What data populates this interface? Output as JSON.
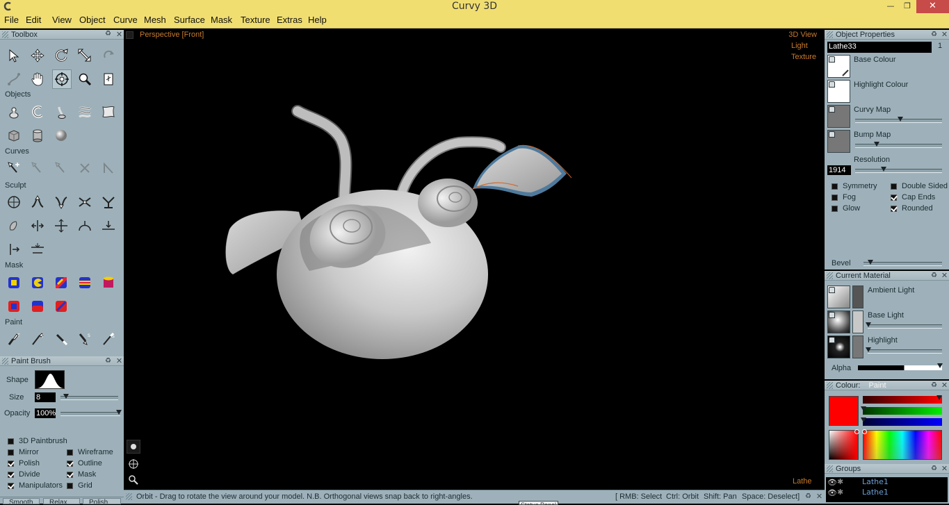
{
  "window": {
    "title": "Curvy 3D"
  },
  "menu": [
    "File",
    "Edit",
    "View",
    "Object",
    "Curve",
    "Mesh",
    "Surface",
    "Mask",
    "Texture",
    "Extras",
    "Help"
  ],
  "toolbox": {
    "title": "Toolbox",
    "sections": {
      "objects": "Objects",
      "curves": "Curves",
      "sculpt": "Sculpt",
      "mask": "Mask",
      "paint": "Paint"
    }
  },
  "paint_brush": {
    "title": "Paint Brush",
    "shape_label": "Shape",
    "size_label": "Size",
    "size_value": "8",
    "size_level": 0.1,
    "opacity_label": "Opacity",
    "opacity_value": "100%",
    "opacity_level": 1.0,
    "options": [
      {
        "label": "3D Paintbrush",
        "checked": false
      },
      {
        "label": "Mirror",
        "checked": false
      },
      {
        "label": "Wireframe",
        "checked": false
      },
      {
        "label": "Polish",
        "checked": true
      },
      {
        "label": "Outline",
        "checked": true
      },
      {
        "label": "Divide",
        "checked": true
      },
      {
        "label": "Mask",
        "checked": true
      },
      {
        "label": "Manipulators",
        "checked": true
      },
      {
        "label": "Grid",
        "checked": false
      }
    ]
  },
  "viewport": {
    "view_name": "Perspective [Front]",
    "modes": [
      "3D View",
      "Light",
      "Texture"
    ],
    "object_type": "Lathe"
  },
  "object_properties": {
    "title": "Object Properties",
    "name": "Lathe33",
    "index": "1",
    "base_colour": "Base Colour",
    "highlight_colour": "Highlight Colour",
    "curvy_map": "Curvy Map",
    "bump_map": "Bump Map",
    "resolution_label": "Resolution",
    "resolution_value": "1914",
    "options": [
      {
        "label": "Symmetry",
        "checked": false
      },
      {
        "label": "Double Sided",
        "checked": false
      },
      {
        "label": "Fog",
        "checked": false
      },
      {
        "label": "Cap Ends",
        "checked": true
      },
      {
        "label": "Glow",
        "checked": false
      },
      {
        "label": "Rounded",
        "checked": true
      }
    ],
    "bevel_label": "Bevel"
  },
  "current_material": {
    "title": "Current Material",
    "ambient": "Ambient Light",
    "base": "Base Light",
    "highlight": "Highlight",
    "alpha": "Alpha"
  },
  "colour": {
    "title": "Colour:",
    "mode": "Paint",
    "value_hex": "#ff0000"
  },
  "groups": {
    "title": "Groups",
    "items": [
      "Lathe1",
      "Lathe1"
    ]
  },
  "status": {
    "hint": "Orbit - Drag to rotate the view around your model. N.B. Orthogonal views snap back to right-angles.",
    "rmb": "[ RMB: Select",
    "ctrl": "Ctrl: Orbit",
    "shift": "Shift: Pan",
    "space": "Space: Deselect]",
    "tabs": [
      "Smooth",
      "Relax",
      "Polish"
    ],
    "status_panel": "Status Panel"
  },
  "colors": {
    "panel": "#9eb1ba",
    "accent": "#c87a2c",
    "titlebar": "#f1de71"
  }
}
